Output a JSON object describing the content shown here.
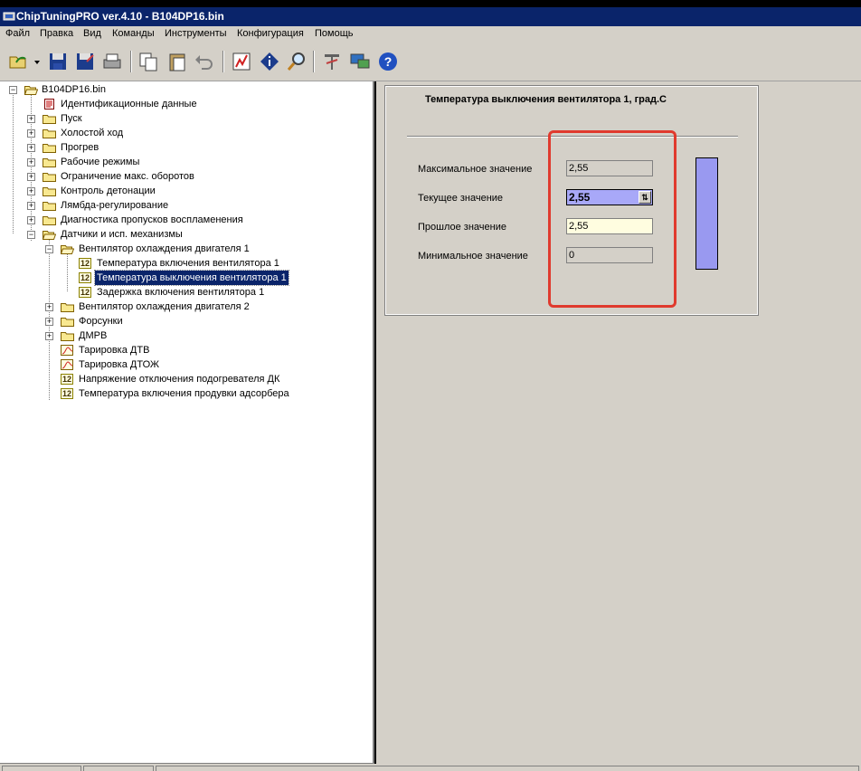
{
  "window": {
    "title": "ChipTuningPRO ver.4.10 - B104DP16.bin"
  },
  "menu": [
    "Файл",
    "Правка",
    "Вид",
    "Команды",
    "Инструменты",
    "Конфигурация",
    "Помощь"
  ],
  "toolbar": {
    "icons": [
      "open-icon",
      "dropdown-arrow-icon",
      "save-icon",
      "save-as-icon",
      "print-icon",
      "copy-icon",
      "paste-icon",
      "undo-icon",
      "chart-icon",
      "info-icon",
      "search-icon",
      "tools-icon",
      "network-icon",
      "help-icon"
    ]
  },
  "tree": {
    "root": "B104DP16.bin",
    "items": [
      "Идентификационные данные",
      "Пуск",
      "Холостой ход",
      "Прогрев",
      "Рабочие режимы",
      "Ограничение макс. оборотов",
      "Контроль детонации",
      "Лямбда-регулирование",
      "Диагностика пропусков воспламенения",
      "Датчики и исп. механизмы",
      "Вентилятор охлаждения двигателя 1",
      "Температура включения вентилятора 1",
      "Температура выключения вентилятора 1",
      "Задержка включения вентилятора 1",
      "Вентилятор охлаждения двигателя 2",
      "Форсунки",
      "ДМРВ",
      "Тарировка ДТВ",
      "Тарировка ДТОЖ",
      "Напряжение отключения подогревателя ДК",
      "Температура включения продувки адсорбера"
    ],
    "badge_text": "12"
  },
  "param": {
    "title": "Температура выключения вентилятора 1, град.С",
    "max_label": "Максимальное значение",
    "max_value": "2,55",
    "cur_label": "Текущее значение",
    "cur_value": "2,55",
    "prev_label": "Прошлое значение",
    "prev_value": "2,55",
    "min_label": "Минимальное значение",
    "min_value": "0",
    "gauge_level": 1.0
  },
  "colors": {
    "titlebar": "#0a246a",
    "face": "#d4d0c8",
    "gauge": "#9999f0",
    "current_field": "#a8a8f8",
    "prev_field": "#fffde0",
    "highlight": "#e03a2e"
  }
}
